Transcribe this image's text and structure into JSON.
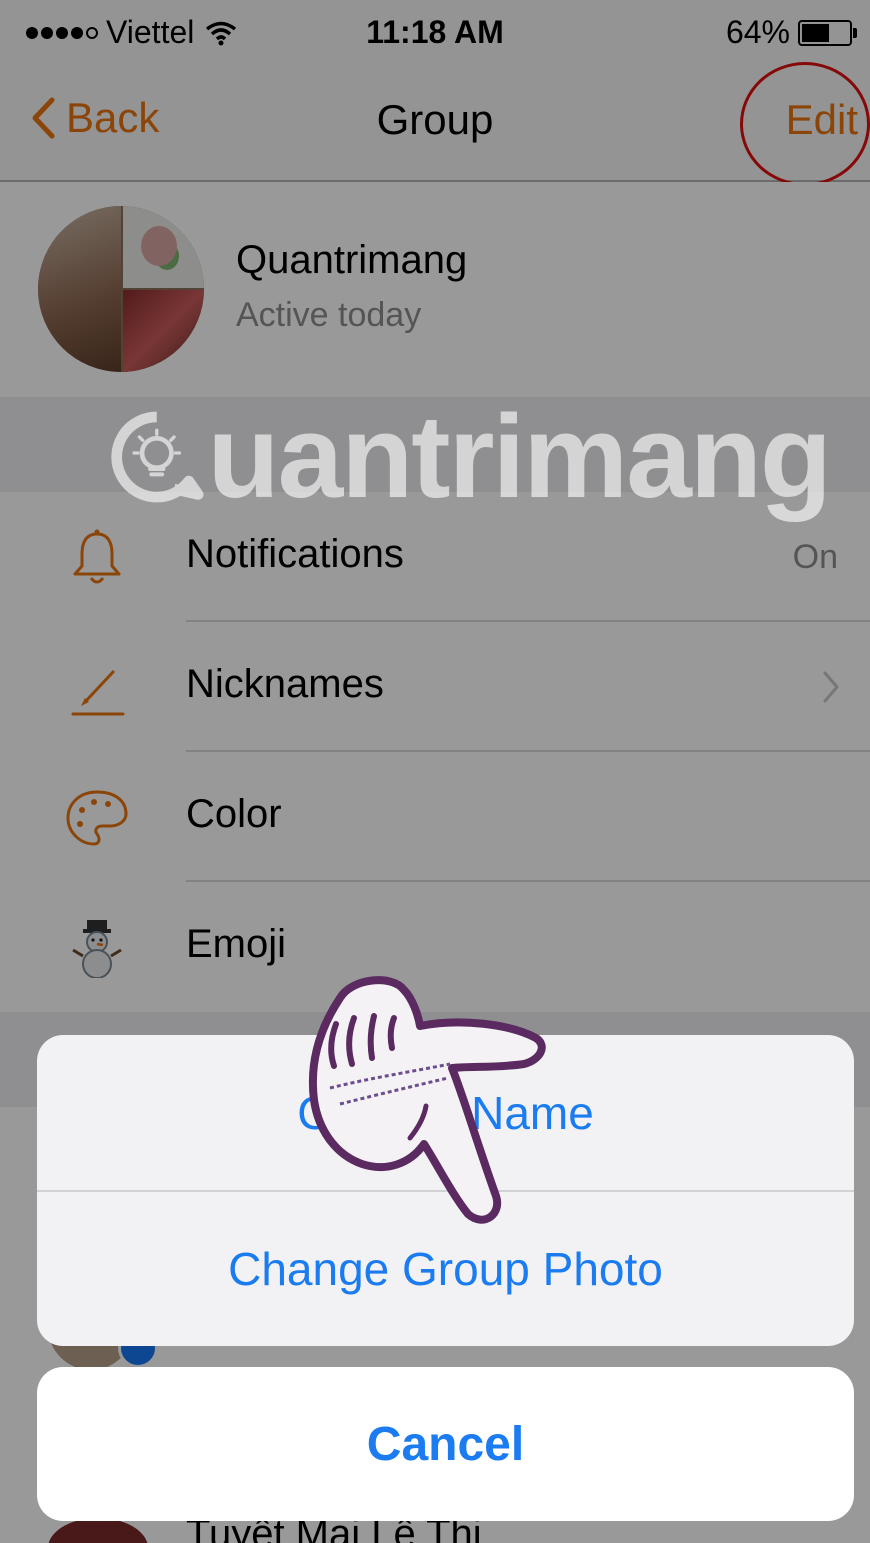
{
  "status_bar": {
    "carrier": "Viettel",
    "time": "11:18 AM",
    "battery": "64%",
    "battery_level": 0.64
  },
  "nav": {
    "back_label": "Back",
    "title": "Group",
    "edit_label": "Edit"
  },
  "group": {
    "name": "Quantrimang",
    "status": "Active today"
  },
  "settings": {
    "notifications": {
      "label": "Notifications",
      "value": "On"
    },
    "nicknames": {
      "label": "Nicknames"
    },
    "color": {
      "label": "Color"
    },
    "emoji": {
      "label": "Emoji"
    }
  },
  "members": {
    "partial_name": "Tuyết Mai Lê Thị"
  },
  "action_sheet": {
    "change_name": "Change Name",
    "change_photo": "Change Group Photo",
    "cancel": "Cancel"
  },
  "watermark": {
    "text": "uantrimang"
  },
  "colors": {
    "accent_orange": "#e8730e",
    "action_blue": "#1a7cf0",
    "highlight_red": "#e01010"
  },
  "icons": {
    "back": "chevron-left-icon",
    "notifications": "bell-icon",
    "nicknames": "pencil-icon",
    "color": "palette-icon",
    "emoji": "snowman-icon",
    "chevron": "chevron-right-icon",
    "pointer": "pointing-hand-icon",
    "watermark_logo": "lightbulb-icon"
  }
}
